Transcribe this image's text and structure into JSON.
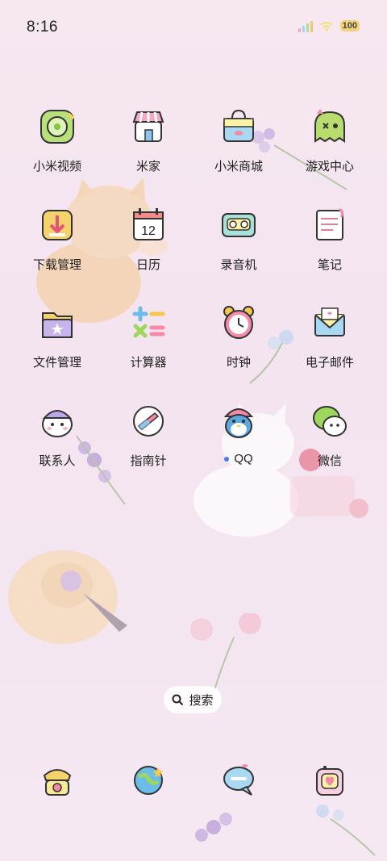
{
  "status_bar": {
    "time": "8:16",
    "battery_level": "100",
    "signal_colors": [
      "#f0a6c8",
      "#9fd7f2",
      "#a4e0a4",
      "#f2c46b"
    ],
    "wifi_color": "#f6e27c"
  },
  "apps": [
    {
      "label": "小米视频",
      "icon": "video-icon"
    },
    {
      "label": "米家",
      "icon": "shop-icon"
    },
    {
      "label": "小米商城",
      "icon": "bag-icon"
    },
    {
      "label": "游戏中心",
      "icon": "ghost-icon"
    },
    {
      "label": "下载管理",
      "icon": "download-icon"
    },
    {
      "label": "日历",
      "icon": "calendar-icon"
    },
    {
      "label": "录音机",
      "icon": "recorder-icon"
    },
    {
      "label": "笔记",
      "icon": "notes-icon"
    },
    {
      "label": "文件管理",
      "icon": "folder-icon"
    },
    {
      "label": "计算器",
      "icon": "calculator-icon"
    },
    {
      "label": "时钟",
      "icon": "clock-icon"
    },
    {
      "label": "电子邮件",
      "icon": "mail-icon"
    },
    {
      "label": "联系人",
      "icon": "contacts-icon"
    },
    {
      "label": "指南针",
      "icon": "compass-icon"
    },
    {
      "label": "QQ",
      "icon": "penguin-icon",
      "notification_dot": true
    },
    {
      "label": "微信",
      "icon": "wechat-icon"
    }
  ],
  "calendar_day": "12",
  "search": {
    "label": "搜索"
  },
  "dock": [
    {
      "icon": "phone-icon"
    },
    {
      "icon": "browser-icon"
    },
    {
      "icon": "messages-icon"
    },
    {
      "icon": "camera-icon"
    }
  ]
}
